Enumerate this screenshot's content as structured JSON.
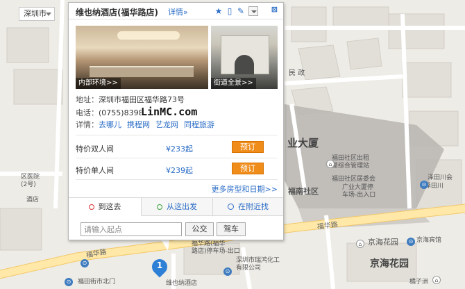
{
  "map": {
    "city": "深圳市",
    "labels": {
      "minzheng": "民\n政",
      "yedasha": "业大厦",
      "futian_community": "福田社区出租\n屋综合管理站",
      "futian_comm_residents": "福田社区居委会",
      "futian_nanshequ": "福南社区",
      "guangye_parking": "广业大厦停\n车场-出入口",
      "zetian_hui": "泽田川会",
      "zetian_chuan": "泽田川",
      "hospital": "区医院\n(2号)",
      "hotel_left": "酒店",
      "road_fuhua_right": "福华路",
      "road_fuhua_left": "福华路",
      "jinghai_garden_poi": "京海花园",
      "jinghai_hotel": "京海宾馆",
      "jinghai_garden_big": "京海花园",
      "parking_road": "福华路(福华\n路店)停车场-出口",
      "ruihong": "深圳市瑞鸿化工\n有限公司",
      "futian_north": "福田街市北门",
      "hotel_marker_label": "维也纳酒店",
      "juzi": "橘子洲"
    }
  },
  "marker": {
    "number": "1"
  },
  "popup": {
    "title": "维也纳酒店(福华路店)",
    "detail_link": "详情»",
    "icons": [
      "star-icon",
      "phone-icon",
      "edit-icon",
      "dropdown-icon",
      "close-icon"
    ],
    "close": "⊠",
    "photos": [
      {
        "caption": "内部环境>>"
      },
      {
        "caption": "街道全景>>"
      }
    ],
    "address_label": "地址：",
    "address": "深圳市福田区福华路73号",
    "phone_label": "电话：",
    "phone": "(0755)8398",
    "watermark": "LinMC.com",
    "details_label": "详情：",
    "detail_links": [
      "去哪儿",
      "携程网",
      "艺龙网",
      "同程旅游"
    ],
    "rooms": [
      {
        "name": "特价双人间",
        "price": "¥233起",
        "book": "预订"
      },
      {
        "name": "特价单人间",
        "price": "¥239起",
        "book": "预订"
      }
    ],
    "more_link": "更多房型和日期>>",
    "tabs": [
      {
        "label": "到这去"
      },
      {
        "label": "从这出发"
      },
      {
        "label": "在附近找"
      }
    ],
    "start_placeholder": "请输入起点",
    "btn_bus": "公交",
    "btn_drive": "驾车"
  }
}
